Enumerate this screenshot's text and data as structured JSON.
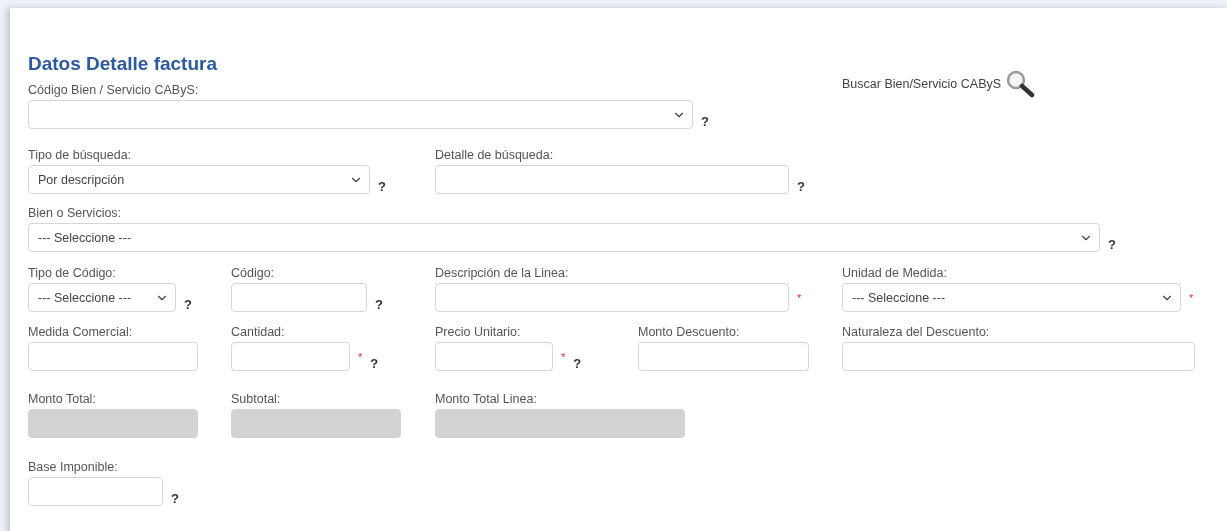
{
  "section": {
    "title": "Datos Detalle factura"
  },
  "search_link": {
    "label": "Buscar Bien/Servicio CAByS"
  },
  "rows": [
    [
      {
        "label": "Código Bien / Servicio CAByS:",
        "kind": "select",
        "disabled": false,
        "help": "?"
      }
    ],
    [
      {
        "label": "Tipo de búsqueda:",
        "kind": "select",
        "value": "Por descripción",
        "disabled": false,
        "help": "?"
      },
      {
        "label": "Detalle de búsqueda:",
        "kind": "input",
        "disabled": false,
        "help": "?"
      }
    ],
    [
      {
        "label": "Bien o Servicios:",
        "kind": "select",
        "value": "--- Seleccione ---",
        "disabled": false,
        "help": "?"
      }
    ],
    [
      {
        "label": "Tipo de Código:",
        "kind": "select",
        "value": "--- Seleccione ---",
        "disabled": false,
        "help": "?"
      },
      {
        "label": "Código:",
        "kind": "input",
        "disabled": false,
        "help": "?"
      },
      {
        "label": "Descripción de la Linea:",
        "kind": "input",
        "disabled": false,
        "required_mark": "*"
      },
      {
        "label": "Unidad de Medida:",
        "kind": "select",
        "value": "--- Seleccione ---",
        "disabled": false,
        "required_mark": "*"
      }
    ],
    [
      {
        "label": "Medida Comercial:",
        "kind": "input",
        "disabled": false
      },
      {
        "label": "Cantidad:",
        "kind": "input",
        "disabled": false,
        "required_mark": "*",
        "help": "?"
      },
      {
        "label": "Precio Unitario:",
        "kind": "input",
        "disabled": false,
        "required_mark": "*",
        "help": "?"
      },
      {
        "label": "Monto Descuento:",
        "kind": "input",
        "disabled": false
      },
      {
        "label": "Naturaleza del Descuento:",
        "kind": "input",
        "disabled": false
      }
    ],
    [
      {
        "label": "Monto Total:",
        "kind": "input",
        "disabled": true
      },
      {
        "label": "Subtotal:",
        "kind": "input",
        "disabled": true
      },
      {
        "label": "Monto Total Linea:",
        "kind": "input",
        "disabled": true
      }
    ],
    [
      {
        "label": "Base Imponible:",
        "kind": "input",
        "disabled": false,
        "help": "?"
      }
    ]
  ]
}
